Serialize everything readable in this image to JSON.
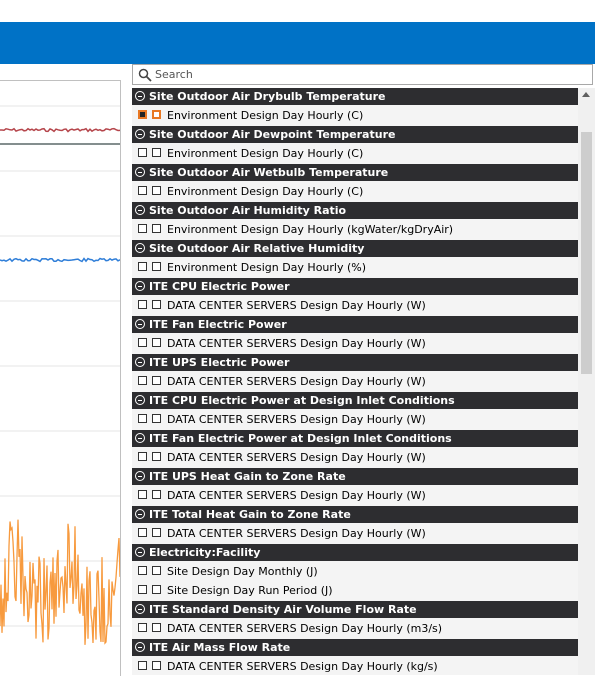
{
  "search": {
    "placeholder": "Search"
  },
  "colors": {
    "topbar": "#0072c6",
    "group_header_bg": "#2d2d30",
    "series_red": "#b5454b",
    "series_dark": "#3a4a4a",
    "series_blue": "#2f7ed8",
    "series_orange": "#f79a3e",
    "selection_outline": "#e87722"
  },
  "groups": [
    {
      "title": "Site Outdoor Air Drybulb Temperature",
      "items": [
        {
          "label": "Environment Design Day Hourly (C)",
          "checked_a": true,
          "selected": true
        }
      ]
    },
    {
      "title": "Site Outdoor Air Dewpoint Temperature",
      "items": [
        {
          "label": "Environment Design Day Hourly (C)"
        }
      ]
    },
    {
      "title": "Site Outdoor Air Wetbulb Temperature",
      "items": [
        {
          "label": "Environment Design Day Hourly (C)"
        }
      ]
    },
    {
      "title": "Site Outdoor Air Humidity Ratio",
      "items": [
        {
          "label": "Environment Design Day Hourly (kgWater/kgDryAir)"
        }
      ]
    },
    {
      "title": "Site Outdoor Air Relative Humidity",
      "items": [
        {
          "label": "Environment Design Day Hourly (%)"
        }
      ]
    },
    {
      "title": "ITE CPU Electric Power",
      "items": [
        {
          "label": "DATA CENTER SERVERS Design Day Hourly (W)"
        }
      ]
    },
    {
      "title": "ITE Fan Electric Power",
      "items": [
        {
          "label": "DATA CENTER SERVERS Design Day Hourly (W)"
        }
      ]
    },
    {
      "title": "ITE UPS Electric Power",
      "items": [
        {
          "label": "DATA CENTER SERVERS Design Day Hourly (W)"
        }
      ]
    },
    {
      "title": "ITE CPU Electric Power at Design Inlet Conditions",
      "items": [
        {
          "label": "DATA CENTER SERVERS Design Day Hourly (W)"
        }
      ]
    },
    {
      "title": "ITE Fan Electric Power at Design Inlet Conditions",
      "items": [
        {
          "label": "DATA CENTER SERVERS Design Day Hourly (W)"
        }
      ]
    },
    {
      "title": "ITE UPS Heat Gain to Zone Rate",
      "items": [
        {
          "label": "DATA CENTER SERVERS Design Day Hourly (W)"
        }
      ]
    },
    {
      "title": "ITE Total Heat Gain to Zone Rate",
      "items": [
        {
          "label": "DATA CENTER SERVERS Design Day Hourly (W)"
        }
      ]
    },
    {
      "title": "Electricity:Facility",
      "items": [
        {
          "label": "Site Design Day Monthly (J)"
        },
        {
          "label": "Site Design Day Run Period (J)"
        }
      ]
    },
    {
      "title": "ITE Standard Density Air Volume Flow Rate",
      "items": [
        {
          "label": "DATA CENTER SERVERS Design Day Hourly (m3/s)"
        }
      ]
    },
    {
      "title": "ITE Air Mass Flow Rate",
      "items": [
        {
          "label": "DATA CENTER SERVERS Design Day Hourly (kg/s)"
        }
      ]
    }
  ]
}
